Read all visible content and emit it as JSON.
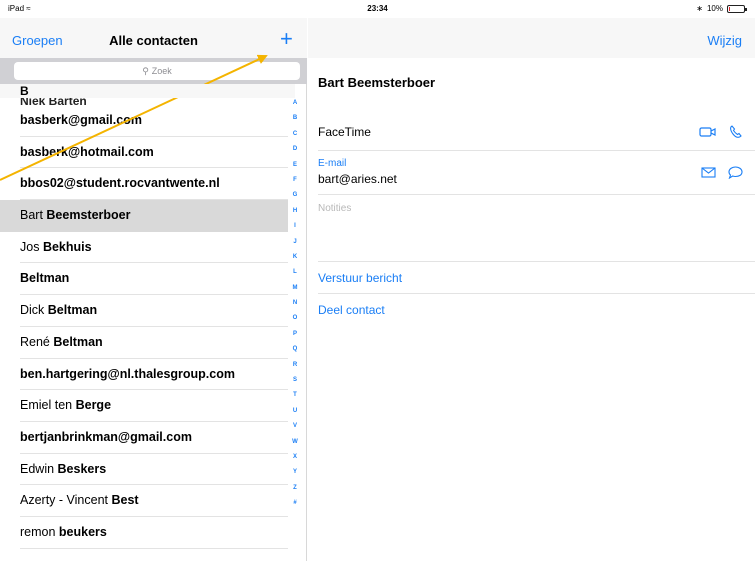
{
  "status": {
    "device": "iPad",
    "time": "23:34",
    "battery": "10%",
    "battery_level": 0.1
  },
  "contacts_nav": {
    "groups": "Groepen",
    "title": "Alle contacten",
    "add": "+"
  },
  "search": {
    "placeholder": "Zoek"
  },
  "list": {
    "section": "B",
    "partial": "Niek Barten",
    "rows": [
      {
        "pre": "",
        "bold": "basberk@gmail.com"
      },
      {
        "pre": "",
        "bold": "basberk@hotmail.com"
      },
      {
        "pre": "",
        "bold": "bbos02@student.rocvantwente.nl"
      },
      {
        "pre": "Bart ",
        "bold": "Beemsterboer",
        "selected": true
      },
      {
        "pre": "Jos ",
        "bold": "Bekhuis"
      },
      {
        "pre": "",
        "bold": "Beltman"
      },
      {
        "pre": "Dick ",
        "bold": "Beltman"
      },
      {
        "pre": "René ",
        "bold": "Beltman"
      },
      {
        "pre": "",
        "bold": "ben.hartgering@nl.thalesgroup.com"
      },
      {
        "pre": "Emiel ten ",
        "bold": "Berge"
      },
      {
        "pre": "",
        "bold": "bertjanbrinkman@gmail.com"
      },
      {
        "pre": "Edwin ",
        "bold": "Beskers"
      },
      {
        "pre": "Azerty - Vincent ",
        "bold": "Best"
      },
      {
        "pre": "remon ",
        "bold": "beukers"
      }
    ]
  },
  "index_letters": [
    "A",
    "B",
    "C",
    "D",
    "E",
    "F",
    "G",
    "H",
    "I",
    "J",
    "K",
    "L",
    "M",
    "N",
    "O",
    "P",
    "Q",
    "R",
    "S",
    "T",
    "U",
    "V",
    "W",
    "X",
    "Y",
    "Z",
    "#"
  ],
  "detail_nav": {
    "edit": "Wijzig"
  },
  "detail": {
    "name": "Bart Beemsterboer",
    "facetime_label": "FaceTime",
    "email_label": "E-mail",
    "email_value": "bart@aries.net",
    "notes_label": "Notities",
    "send_message": "Verstuur bericht",
    "share_contact": "Deel contact"
  },
  "colors": {
    "accent": "#1a7ef5",
    "annotation_arrow": "#f4b400"
  }
}
